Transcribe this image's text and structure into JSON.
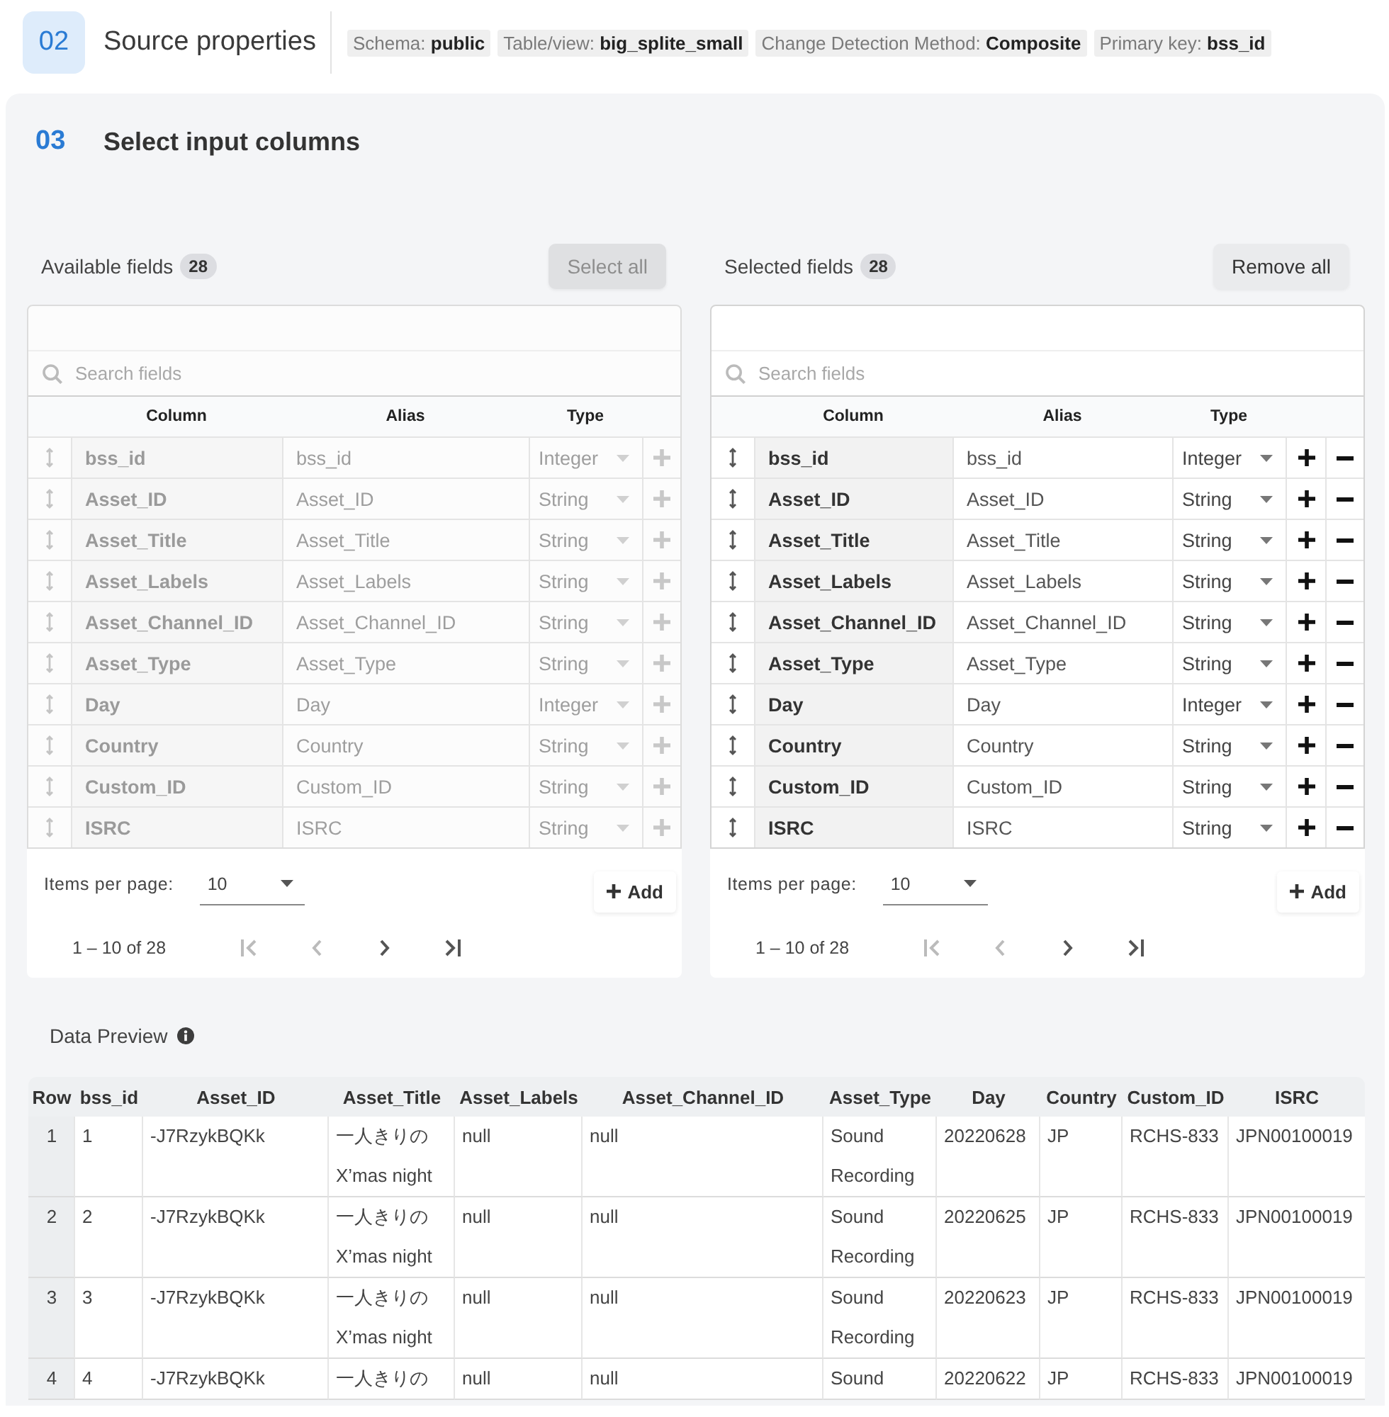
{
  "source_step": {
    "number": "02",
    "title": "Source properties",
    "chips": [
      "Schema: **public**",
      "Table/view: **big_splite_small**",
      "Change Detection Method: **Composite**",
      "Primary key: **bss_id**"
    ]
  },
  "input_step": {
    "number": "03",
    "title": "Select input columns"
  },
  "field_panels": [
    {
      "title": "Available fields",
      "count": "28",
      "action": {
        "label": "Select all",
        "disabled": true
      },
      "disabled": true,
      "search": {
        "placeholder": "Search fields"
      },
      "columns": [
        "Column",
        "Alias",
        "Type"
      ],
      "row_actions": [
        {
          "kind": "add"
        }
      ],
      "rows": [
        {
          "column": "bss_id",
          "alias": "bss_id",
          "type": "Integer"
        },
        {
          "column": "Asset_ID",
          "alias": "Asset_ID",
          "type": "String"
        },
        {
          "column": "Asset_Title",
          "alias": "Asset_Title",
          "type": "String"
        },
        {
          "column": "Asset_Labels",
          "alias": "Asset_Labels",
          "type": "String"
        },
        {
          "column": "Asset_Channel_ID",
          "alias": "Asset_Channel_ID",
          "type": "String"
        },
        {
          "column": "Asset_Type",
          "alias": "Asset_Type",
          "type": "String"
        },
        {
          "column": "Day",
          "alias": "Day",
          "type": "Integer"
        },
        {
          "column": "Country",
          "alias": "Country",
          "type": "String"
        },
        {
          "column": "Custom_ID",
          "alias": "Custom_ID",
          "type": "String"
        },
        {
          "column": "ISRC",
          "alias": "ISRC",
          "type": "String"
        }
      ],
      "items_per_page_label": "Items per page:",
      "items_per_page": "10",
      "add_label": "Add",
      "range": "1 – 10 of 28",
      "pager": [
        {
          "kind": "first",
          "disabled": true
        },
        {
          "kind": "prev",
          "disabled": true
        },
        {
          "kind": "next",
          "disabled": false
        },
        {
          "kind": "last",
          "disabled": false
        }
      ]
    },
    {
      "title": "Selected fields",
      "count": "28",
      "action": {
        "label": "Remove all",
        "disabled": false
      },
      "disabled": false,
      "search": {
        "placeholder": "Search fields"
      },
      "columns": [
        "Column",
        "Alias",
        "Type"
      ],
      "row_actions": [
        {
          "kind": "add"
        },
        {
          "kind": "remove"
        }
      ],
      "rows": [
        {
          "column": "bss_id",
          "alias": "bss_id",
          "type": "Integer"
        },
        {
          "column": "Asset_ID",
          "alias": "Asset_ID",
          "type": "String"
        },
        {
          "column": "Asset_Title",
          "alias": "Asset_Title",
          "type": "String"
        },
        {
          "column": "Asset_Labels",
          "alias": "Asset_Labels",
          "type": "String"
        },
        {
          "column": "Asset_Channel_ID",
          "alias": "Asset_Channel_ID",
          "type": "String"
        },
        {
          "column": "Asset_Type",
          "alias": "Asset_Type",
          "type": "String"
        },
        {
          "column": "Day",
          "alias": "Day",
          "type": "Integer"
        },
        {
          "column": "Country",
          "alias": "Country",
          "type": "String"
        },
        {
          "column": "Custom_ID",
          "alias": "Custom_ID",
          "type": "String"
        },
        {
          "column": "ISRC",
          "alias": "ISRC",
          "type": "String"
        }
      ],
      "items_per_page_label": "Items per page:",
      "items_per_page": "10",
      "add_label": "Add",
      "range": "1 – 10 of 28",
      "pager": [
        {
          "kind": "first",
          "disabled": true
        },
        {
          "kind": "prev",
          "disabled": true
        },
        {
          "kind": "next",
          "disabled": false
        },
        {
          "kind": "last",
          "disabled": false
        }
      ]
    }
  ],
  "data_preview": {
    "title": "Data Preview",
    "columns": [
      "Row",
      "bss_id",
      "Asset_ID",
      "Asset_Title",
      "Asset_Labels",
      "Asset_Channel_ID",
      "Asset_Type",
      "Day",
      "Country",
      "Custom_ID",
      "ISRC"
    ],
    "rows": [
      [
        "1",
        "1",
        "-J7RzykBQKk",
        "一人きりの X’mas night",
        "null",
        "null",
        "Sound Recording",
        "20220628",
        "JP",
        "RCHS-833",
        "JPN00100019"
      ],
      [
        "2",
        "2",
        "-J7RzykBQKk",
        "一人きりの X’mas night",
        "null",
        "null",
        "Sound Recording",
        "20220625",
        "JP",
        "RCHS-833",
        "JPN00100019"
      ],
      [
        "3",
        "3",
        "-J7RzykBQKk",
        "一人きりの X’mas night",
        "null",
        "null",
        "Sound Recording",
        "20220623",
        "JP",
        "RCHS-833",
        "JPN00100019"
      ],
      [
        "4",
        "4",
        "-J7RzykBQKk",
        "一人きりの",
        "null",
        "null",
        "Sound",
        "20220622",
        "JP",
        "RCHS-833",
        "JPN00100019"
      ]
    ]
  }
}
